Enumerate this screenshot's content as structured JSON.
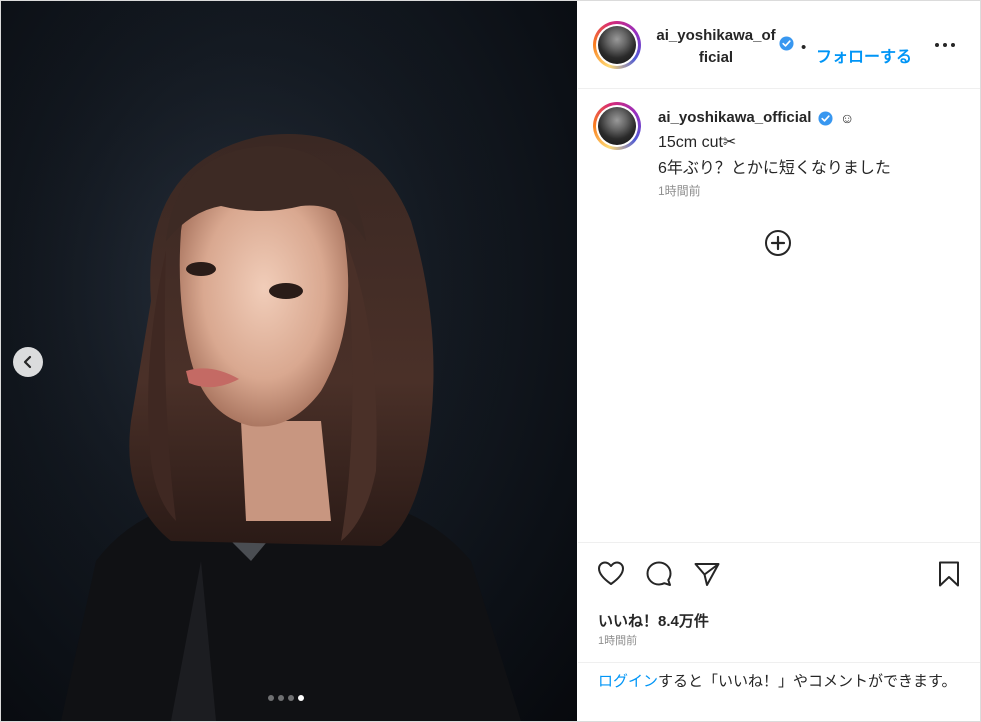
{
  "post": {
    "username": "ai_yoshikawa_official",
    "header_username": "ai_yoshikawa_official",
    "follow_label": "フォローする",
    "separator": "•",
    "caption_emoji": "☺",
    "caption_line1": "15cm cut✂",
    "caption_line2": "6年ぶり？とかに短くなりました",
    "caption_time": "1時間前",
    "likes": "いいね！8.4万件",
    "time": "1時間前"
  },
  "login_prompt": {
    "link": "ログイン",
    "text": "すると「いいね！」やコメントができます。"
  },
  "carousel": {
    "total": 4,
    "active_index": 3
  },
  "icons": {
    "verified": "verified-badge-icon",
    "more": "more-options-icon",
    "add": "add-comment-icon",
    "like": "heart-icon",
    "comment": "comment-icon",
    "share": "share-icon",
    "save": "bookmark-icon",
    "prev": "chevron-left-icon"
  },
  "colors": {
    "accent": "#0095f6",
    "verified": "#3897f0",
    "text": "#262626",
    "muted": "#8e8e8e"
  }
}
